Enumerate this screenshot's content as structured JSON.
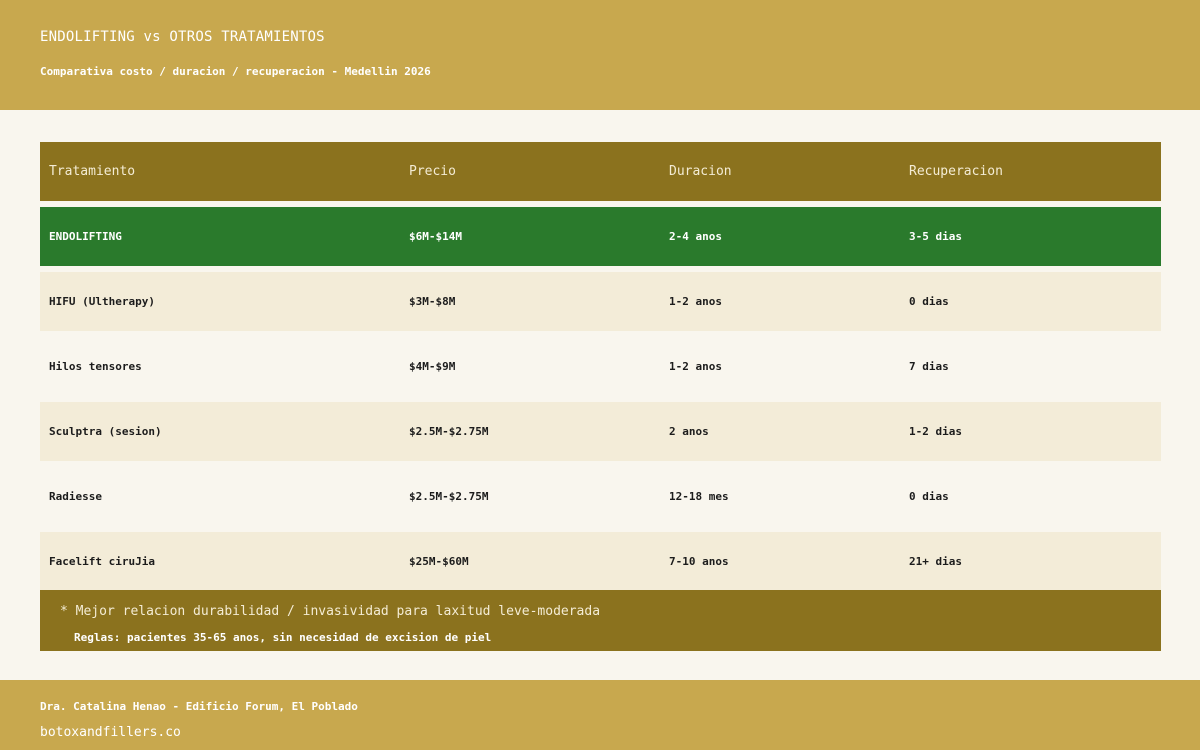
{
  "header": {
    "title": "ENDOLIFTING vs OTROS TRATAMIENTOS",
    "subtitle": "Comparativa costo / duracion / recuperacion - Medellin 2026"
  },
  "table": {
    "columns": [
      "Tratamiento",
      "Precio",
      "Duracion",
      "Recuperacion"
    ],
    "rows": [
      [
        "ENDOLIFTING",
        "$6M-$14M",
        "2-4 anos",
        "3-5 dias"
      ],
      [
        "HIFU (Ultherapy)",
        "$3M-$8M",
        "1-2 anos",
        "0 dias"
      ],
      [
        "Hilos tensores",
        "$4M-$9M",
        "1-2 anos",
        "7 dias"
      ],
      [
        "Sculptra (sesion)",
        "$2.5M-$2.75M",
        "2 anos",
        "1-2 dias"
      ],
      [
        "Radiesse",
        "$2.5M-$2.75M",
        "12-18 mes",
        "0 dias"
      ],
      [
        "Facelift ciruJia",
        "$25M-$60M",
        "7-10 anos",
        "21+ dias"
      ]
    ]
  },
  "note": {
    "main": "* Mejor relacion durabilidad / invasividad para laxitud leve-moderada",
    "sub": "Reglas: pacientes 35-65 anos, sin necesidad de excision de piel"
  },
  "footer": {
    "name": "Dra. Catalina Henao - Edificio Forum, El Poblado",
    "url": "botoxandfillers.co"
  },
  "colors": {
    "header_bg": "#c8a84e",
    "table_head_bg": "#8b721e",
    "highlight_row_bg": "#2a7a2c",
    "alt_row_bg": "#f3ecd8",
    "page_bg": "#f9f6ee"
  }
}
